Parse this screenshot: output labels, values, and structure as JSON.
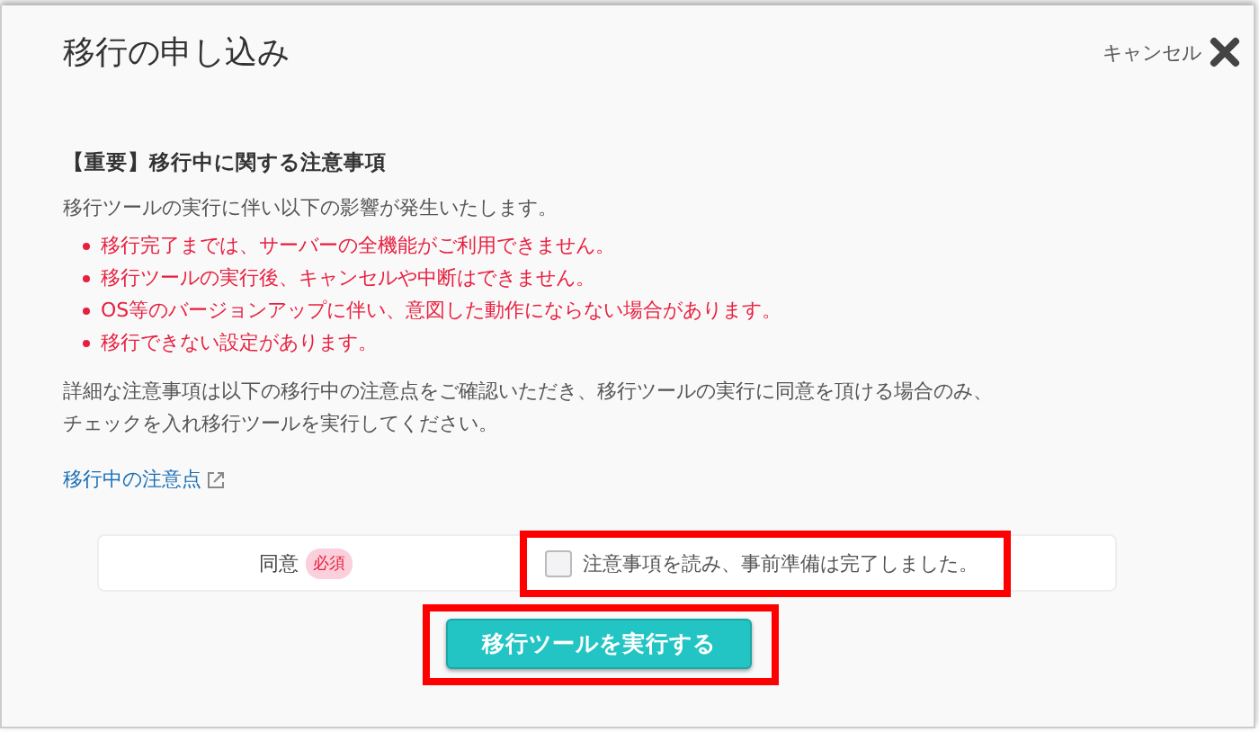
{
  "dialog": {
    "title": "移行の申し込み",
    "cancel_label": "キャンセル"
  },
  "notice": {
    "heading": "【重要】移行中に関する注意事項",
    "intro": "移行ツールの実行に伴い以下の影響が発生いたします。",
    "warnings": [
      "移行完了までは、サーバーの全機能がご利用できません。",
      "移行ツールの実行後、キャンセルや中断はできません。",
      "OS等のバージョンアップに伴い、意図した動作にならない場合があります。",
      "移行できない設定があります。"
    ],
    "details": [
      "詳細な注意事項は以下の移行中の注意点をご確認いただき、移行ツールの実行に同意を頂ける場合のみ、",
      "チェックを入れ移行ツールを実行してください。"
    ],
    "link": "移行中の注意点"
  },
  "agreement": {
    "label": "同意",
    "badge": "必須",
    "checkbox_label": "注意事項を読み、事前準備は完了しました。",
    "checked": false,
    "highlighted": true
  },
  "submit": {
    "label": "移行ツールを実行する",
    "highlighted": true
  }
}
